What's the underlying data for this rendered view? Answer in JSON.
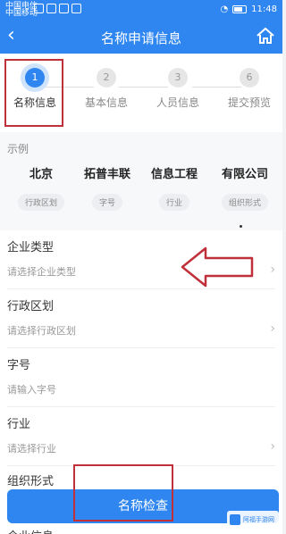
{
  "status_bar": {
    "left_text": "中国电信\n中国移动",
    "time": "11:48"
  },
  "nav": {
    "title": "名称申请信息"
  },
  "steps": [
    {
      "num": "1",
      "label": "名称信息"
    },
    {
      "num": "2",
      "label": "基本信息"
    },
    {
      "num": "3",
      "label": "人员信息"
    },
    {
      "num": "6",
      "label": "提交预览"
    }
  ],
  "example": {
    "title": "示例",
    "items": [
      {
        "value": "北京",
        "tag": "行政区划"
      },
      {
        "value": "拓普丰联",
        "tag": "字号"
      },
      {
        "value": "信息工程",
        "tag": "行业"
      },
      {
        "value": "有限公司",
        "tag": "组织形式"
      }
    ]
  },
  "form": {
    "fields": [
      {
        "label": "企业类型",
        "placeholder": "请选择企业类型"
      },
      {
        "label": "行政区划",
        "placeholder": "请选择行政区划"
      },
      {
        "label": "字号",
        "placeholder": "请输入字号"
      },
      {
        "label": "行业",
        "placeholder": "请选择行业"
      },
      {
        "label": "组织形式",
        "placeholder": ""
      }
    ],
    "check_button": "名称检查",
    "next_label": "企业信息"
  },
  "watermark": "阿福手游网",
  "colors": {
    "primary": "#2f86f0",
    "highlight": "#c0303a"
  }
}
